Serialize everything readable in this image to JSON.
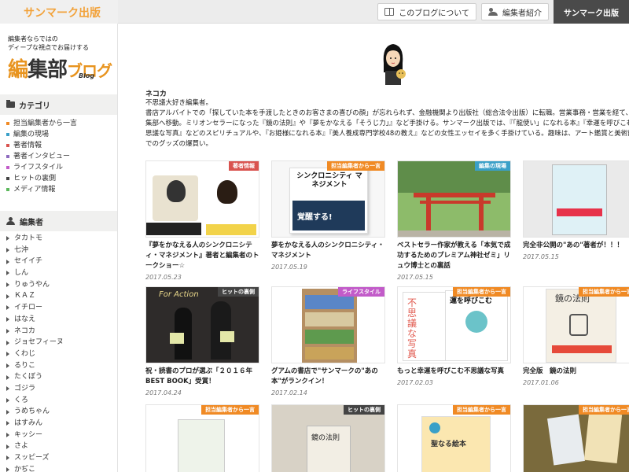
{
  "header": {
    "brand": "サンマーク出版",
    "nav": [
      {
        "label": "このブログについて",
        "icon": "book-icon"
      },
      {
        "label": "編集者紹介",
        "icon": "people-icon"
      },
      {
        "label": "サンマーク出版",
        "icon": ""
      }
    ]
  },
  "sidebar": {
    "tagline_1": "編集者ならではの",
    "tagline_2": "ディープな視点でお届けする",
    "logo_main_1": "編",
    "logo_main_2": "集部",
    "logo_accent": "ブログ",
    "logo_sub": "Blog",
    "category_heading": "カテゴリ",
    "categories": [
      {
        "label": "担当編集者から一言",
        "color": "#f08a24"
      },
      {
        "label": "編集の現場",
        "color": "#3aa0c8"
      },
      {
        "label": "著者情報",
        "color": "#d9534f"
      },
      {
        "label": "著者インタビュー",
        "color": "#8e6bbf"
      },
      {
        "label": "ライフスタイル",
        "color": "#c25bc9"
      },
      {
        "label": "ヒットの裏側",
        "color": "#444444"
      },
      {
        "label": "メディア情報",
        "color": "#5cb85c"
      }
    ],
    "editor_heading": "編集者",
    "editors": [
      "タカトモ",
      "七沖",
      "セイイチ",
      "しん",
      "りゅうやん",
      "ＫＡＺ",
      "イチロー",
      "はなえ",
      "ネコカ",
      "ジョセフィーヌ",
      "くわじ",
      "るりこ",
      "たくぼう",
      "ゴジラ",
      "くろ",
      "うめちゃん",
      "はすみん",
      "キッシー",
      "さよ",
      "スッピーズ",
      "かぢこ"
    ]
  },
  "profile": {
    "name": "ネコカ",
    "desc": "不思議大好き編集者。\n書店アルバイトでの「探していた本を手渡したときのお客さまの喜びの顔」が忘れられず、金融機関より出版社（総合法令出版）に転職。営業事務・営業を経て、編集部へ移動。ミリオンセラーになった『鏡の法則』や『夢をかなえる「そうじ力」』など手掛ける。サンマーク出版では、『「龍使い」になれる本』『幸運を呼びこむ不思議な写真』などのスピリチュアルや、『お姫様になれる本』『美人養成専門学校48の教え』などの女性エッセイを多く手掛けている。趣味は、アート鑑賞と美術館でのグッズの爆買い。"
  },
  "posts": [
    {
      "title": "『夢をかなえる人のシンクロニシティ・マネジメント』著者と編集者のトークショー☆",
      "date": "2017.05.23",
      "badge": "著者情報",
      "badge_color": "#d9534f",
      "thumb": "talk"
    },
    {
      "title": "夢をかなえる人のシンクロニシティ・マネジメント",
      "date": "2017.05.19",
      "badge": "担当編集者から一言",
      "badge_color": "#f08a24",
      "thumb": "book1",
      "book_text": "シンクロニシティ マネジメント",
      "book_sub": "覚醒する!"
    },
    {
      "title": "ベストセラー作家が教える「本気で成功するためのプレミアム神社ゼミ」リュウ博士との裏話",
      "date": "2017.05.15",
      "badge": "編集の現場",
      "badge_color": "#3aa0c8",
      "thumb": "shrine"
    },
    {
      "title": "完全非公開の\"あの\"著者が！！！",
      "date": "2017.05.15",
      "badge": "",
      "badge_color": "",
      "thumb": "book2"
    },
    {
      "title": "祝・読書のプロが選ぶ「２０１６年BEST BOOK」受賞！",
      "date": "2017.04.24",
      "badge": "ヒットの裏側",
      "badge_color": "#444444",
      "thumb": "award",
      "thumb_text": "For Action"
    },
    {
      "title": "グアムの書店で\"サンマークの\"あの本\"がランクイン！",
      "date": "2017.02.14",
      "badge": "ライフスタイル",
      "badge_color": "#c25bc9",
      "thumb": "store"
    },
    {
      "title": "もっと幸運を呼びこむ不思議な写真",
      "date": "2017.02.03",
      "badge": "担当編集者から一言",
      "badge_color": "#f08a24",
      "thumb": "book3",
      "book_text": "不思議な写真",
      "book_sub": "運を呼びこむ"
    },
    {
      "title": "完全版　鏡の法則",
      "date": "2017.01.06",
      "badge": "担当編集者から一言",
      "badge_color": "#f08a24",
      "thumb": "book4",
      "book_text": "鏡の法則"
    },
    {
      "title": "",
      "date": "",
      "badge": "担当編集者から一言",
      "badge_color": "#f08a24",
      "thumb": "book5"
    },
    {
      "title": "",
      "date": "",
      "badge": "ヒットの裏側",
      "badge_color": "#444444",
      "thumb": "book6",
      "book_text": "鏡の法則"
    },
    {
      "title": "",
      "date": "",
      "badge": "担当編集者から一言",
      "badge_color": "#f08a24",
      "thumb": "book7",
      "book_text": "聖なる絵本"
    },
    {
      "title": "",
      "date": "",
      "badge": "担当編集者から一言",
      "badge_color": "#f08a24",
      "thumb": "book8"
    }
  ]
}
